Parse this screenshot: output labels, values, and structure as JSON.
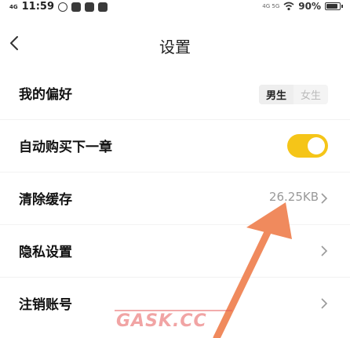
{
  "status_bar": {
    "signal": "4G",
    "time": "11:59",
    "network_small": "4G 5G",
    "battery": "90%",
    "battery_level": 0.9
  },
  "nav": {
    "title": "设置"
  },
  "settings": [
    {
      "label": "我的偏好",
      "gender_options": [
        "男生",
        "女生"
      ],
      "selected": "男生"
    },
    {
      "label": "自动购买下一章",
      "toggle_on": true,
      "accent_color": "#f5c518"
    },
    {
      "label": "清除缓存",
      "value": "26.25KB"
    },
    {
      "label": "隐私设置"
    },
    {
      "label": "注销账号"
    }
  ],
  "watermark": "GASK.CC",
  "annotation_color": "#f08a5d"
}
